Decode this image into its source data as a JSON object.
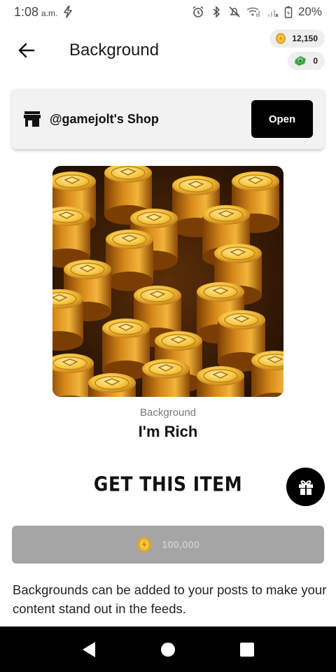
{
  "status_bar": {
    "time": "1:08",
    "ampm": "a.m.",
    "battery": "20%",
    "icons": [
      "flash-icon",
      "alarm-icon",
      "bluetooth-icon",
      "mute-icon",
      "wifi-icon",
      "signal-icon",
      "battery-icon"
    ]
  },
  "header": {
    "title": "Background",
    "coins": "12,150",
    "gems": "0"
  },
  "shop": {
    "name": "@gamejolt's Shop",
    "open_label": "Open"
  },
  "item": {
    "kind": "Background",
    "name": "I'm Rich",
    "image_description": "stacks of gold coins"
  },
  "purchase": {
    "title": "GET THIS ITEM",
    "price": "100,000"
  },
  "description": "Backgrounds can be added to your posts to make your content stand out in the feeds.",
  "colors": {
    "accent": "#000000",
    "coin_gold": "#e0a826",
    "gem_green": "#3aa34a",
    "disabled_button": "#a5a5a5",
    "card_bg": "#f2f2f2"
  }
}
